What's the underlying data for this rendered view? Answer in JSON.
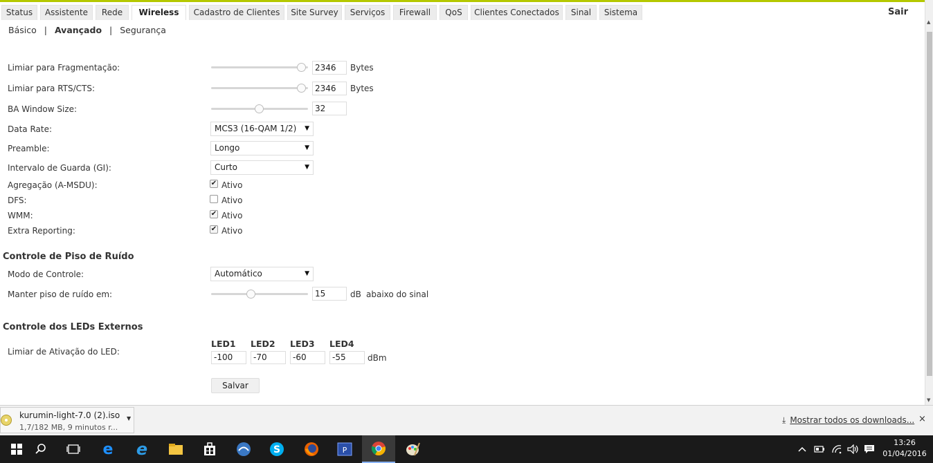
{
  "nav": {
    "tabs": [
      {
        "label": "Status",
        "active": false
      },
      {
        "label": "Assistente",
        "active": false
      },
      {
        "label": "Rede",
        "active": false
      },
      {
        "label": "Wireless",
        "active": true
      },
      {
        "label": "Cadastro de Clientes",
        "active": false
      },
      {
        "label": "Site Survey",
        "active": false
      },
      {
        "label": "Serviços",
        "active": false
      },
      {
        "label": "Firewall",
        "active": false
      },
      {
        "label": "QoS",
        "active": false
      },
      {
        "label": "Clientes Conectados",
        "active": false
      },
      {
        "label": "Sinal",
        "active": false
      },
      {
        "label": "Sistema",
        "active": false
      }
    ],
    "logout": "Sair"
  },
  "subnav": {
    "items": [
      "Básico",
      "Avançado",
      "Segurança"
    ],
    "separator": "|",
    "active": "Avançado"
  },
  "advanced": {
    "frag": {
      "label": "Limiar para Fragmentação:",
      "value": "2346",
      "unit": "Bytes",
      "slider_fraction": 0.93
    },
    "rts": {
      "label": "Limiar para RTS/CTS:",
      "value": "2346",
      "unit": "Bytes",
      "slider_fraction": 0.93
    },
    "ba": {
      "label": "BA Window Size:",
      "value": "32",
      "slider_fraction": 0.49
    },
    "data_rate": {
      "label": "Data Rate:",
      "selected": "MCS3 (16-QAM 1/2)"
    },
    "preamble": {
      "label": "Preamble:",
      "selected": "Longo"
    },
    "gi": {
      "label": "Intervalo de Guarda (GI):",
      "selected": "Curto"
    },
    "amsdu": {
      "label": "Agregação (A-MSDU):",
      "checkbox_label": "Ativo",
      "checked": true
    },
    "dfs": {
      "label": "DFS:",
      "checkbox_label": "Ativo",
      "checked": false
    },
    "wmm": {
      "label": "WMM:",
      "checkbox_label": "Ativo",
      "checked": true
    },
    "extra": {
      "label": "Extra Reporting:",
      "checkbox_label": "Ativo",
      "checked": true
    }
  },
  "noise": {
    "title": "Controle de Piso de Ruído",
    "mode": {
      "label": "Modo de Controle:",
      "selected": "Automático"
    },
    "floor": {
      "label": "Manter piso de ruído em:",
      "value": "15",
      "unit": "dB",
      "suffix": "abaixo do sinal",
      "slider_fraction": 0.41
    }
  },
  "leds": {
    "title": "Controle dos LEDs Externos",
    "label": "Limiar de Ativação do LED:",
    "headers": [
      "LED1",
      "LED2",
      "LED3",
      "LED4"
    ],
    "values": [
      "-100",
      "-70",
      "-60",
      "-55"
    ],
    "unit": "dBm"
  },
  "actions": {
    "save": "Salvar"
  },
  "downloads": {
    "file": "kurumin-light-7.0 (2).iso",
    "status": "1,7/182 MB, 9 minutos r...",
    "show_all": "Mostrar todos os downloads...",
    "close": "×"
  },
  "taskbar": {
    "time": "13:26",
    "date": "01/04/2016"
  },
  "icons": {
    "dropdown": "▼",
    "check": "✔"
  }
}
